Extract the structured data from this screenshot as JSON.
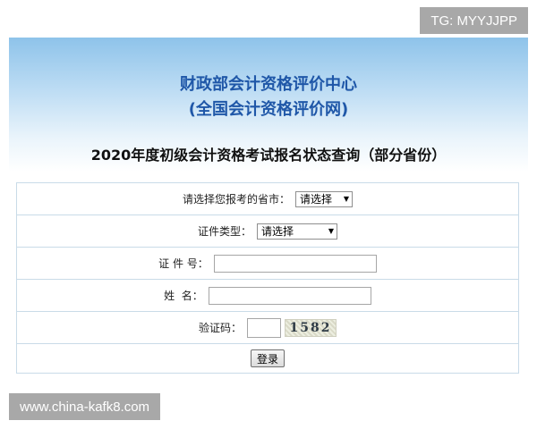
{
  "header": {
    "org_line1": "财政部会计资格评价中心",
    "org_line2": "(全国会计资格评价网)",
    "page_title": "2020年度初级会计资格考试报名状态查询（部分省份）"
  },
  "form": {
    "province_label": "请选择您报考的省市：",
    "province_selected": "请选择",
    "id_type_label": "证件类型：",
    "id_type_selected": "请选择",
    "id_number_label": "证 件 号：",
    "id_number_value": "",
    "name_label": "姓  名：",
    "name_value": "",
    "captcha_label": "验证码：",
    "captcha_value": "",
    "captcha_image_text": "1582",
    "login_label": "登录"
  },
  "watermarks": {
    "tg": "TG: MYYJJPP",
    "site": "www.china-kafk8.com"
  },
  "colors": {
    "title_blue": "#1f57a8",
    "band_top": "#8ec3ea",
    "table_border": "#c9dbe8",
    "watermark_bg": "#a8a8a8"
  }
}
